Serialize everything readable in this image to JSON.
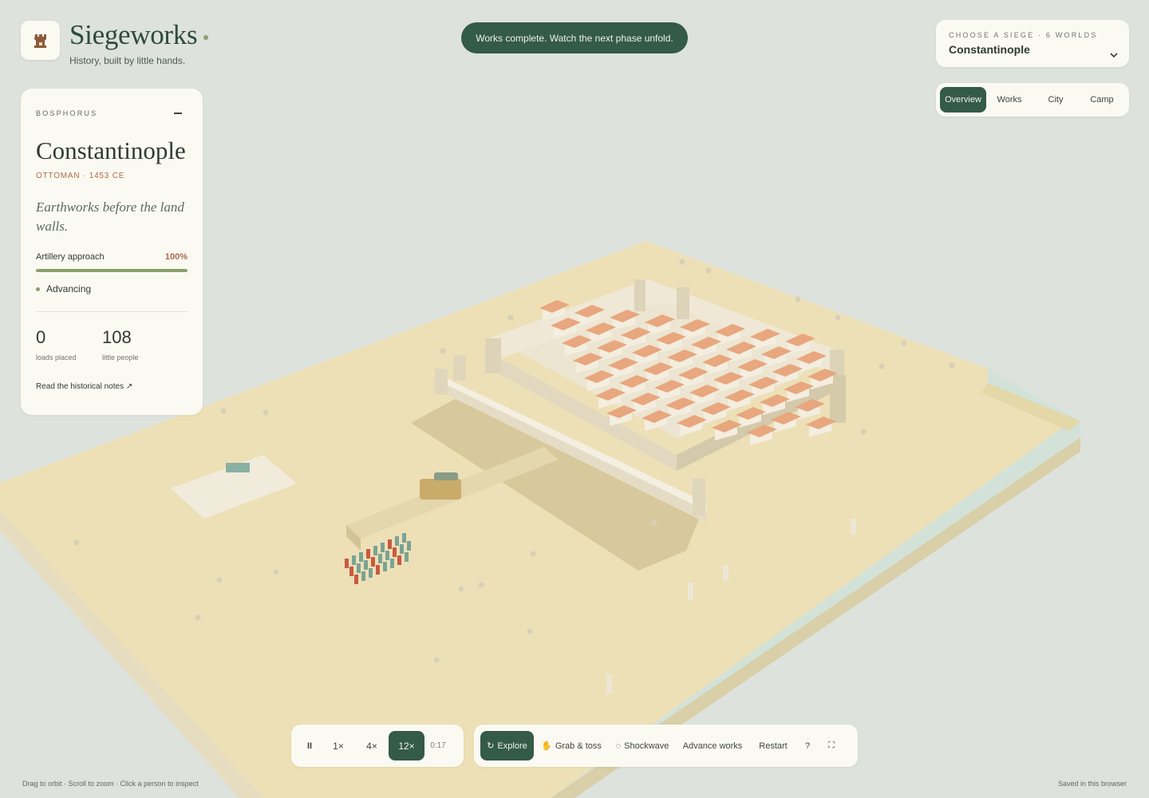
{
  "brand": {
    "title": "Siegeworks",
    "tagline": "History, built by little hands.",
    "logo_icon": "castle-rook-icon"
  },
  "toast": {
    "message": "Works complete. Watch the next phase unfold."
  },
  "siege_selector": {
    "caption": "CHOOSE A SIEGE · 6 WORLDS",
    "selected": "Constantinople"
  },
  "view_tabs": [
    {
      "label": "Overview",
      "active": true
    },
    {
      "label": "Works",
      "active": false
    },
    {
      "label": "City",
      "active": false
    },
    {
      "label": "Camp",
      "active": false
    }
  ],
  "info_card": {
    "region": "BOSPHORUS",
    "title": "Constantinople",
    "era": "OTTOMAN · 1453 CE",
    "subtitle": "Earthworks before the land walls.",
    "progress_label": "Artillery approach",
    "progress_value": "100%",
    "progress_fraction": 1.0,
    "status": "Advancing",
    "stats": [
      {
        "value": "0",
        "label": "loads placed"
      },
      {
        "value": "108",
        "label": "little people"
      }
    ],
    "notes_link": "Read the historical notes ↗"
  },
  "speed_controls": {
    "pause_label": "II",
    "speeds": [
      {
        "label": "1×",
        "active": false
      },
      {
        "label": "4×",
        "active": false
      },
      {
        "label": "12×",
        "active": true
      }
    ],
    "timer": "0:17"
  },
  "tools": [
    {
      "label": "Explore",
      "icon": "refresh-icon",
      "glyph": "↻",
      "active": true
    },
    {
      "label": "Grab & toss",
      "icon": "hand-icon",
      "glyph": "✋",
      "active": false
    },
    {
      "label": "Shockwave",
      "icon": "ring-icon",
      "glyph": "◌",
      "active": false
    },
    {
      "label": "Advance works",
      "active": false
    },
    {
      "label": "Restart",
      "active": false
    },
    {
      "label": "?",
      "active": false
    },
    {
      "label": "⛶",
      "icon": "fullscreen-icon",
      "active": false
    }
  ],
  "footer": {
    "hint": "Drag to orbit · Scroll to zoom · Click a person to inspect",
    "saved": "Saved in this browser"
  },
  "colors": {
    "accent": "#345a48",
    "sand": "#ede0b6",
    "water": "#d3e2d8",
    "roof": "#e8a77e",
    "wall": "#ebe4d0",
    "progress": "#8aa06b",
    "era": "#b0684a"
  }
}
